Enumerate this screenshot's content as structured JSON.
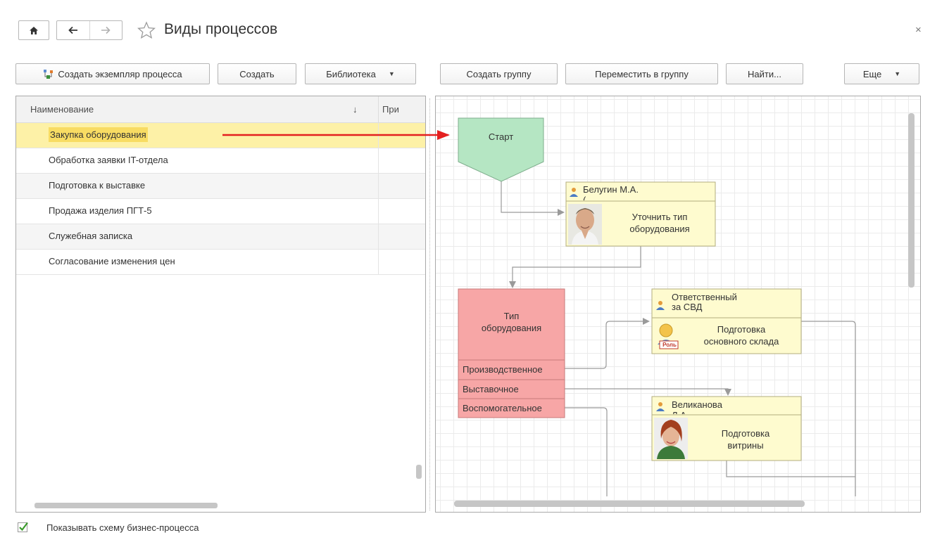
{
  "window": {
    "title": "Виды процессов",
    "close": "×"
  },
  "toolbar": {
    "create_instance": "Создать экземпляр процесса",
    "create": "Создать",
    "library": "Библиотека",
    "create_group": "Создать группу",
    "move_to_group": "Переместить в группу",
    "find": "Найти...",
    "more": "Еще"
  },
  "list": {
    "col_name": "Наименование",
    "sort_indicator": "↓",
    "col_pri": "При",
    "rows": [
      "Закупка оборудования",
      "Обработка заявки IT-отдела",
      "Подготовка к выставке",
      "Продажа изделия ПГТ-5",
      "Служебная записка",
      "Согласование изменения цен"
    ]
  },
  "flow": {
    "start": "Старт",
    "task1": {
      "assignee": "Белугин М.А.",
      "assignee_more": "(",
      "line1": "Уточнить тип",
      "line2": "оборудования"
    },
    "condition": {
      "line1": "Тип",
      "line2": "оборудования",
      "options": [
        "Производственное",
        "Выставочное",
        "Воспомогательное"
      ]
    },
    "task2": {
      "assignee1": "Ответственный",
      "assignee2": "за СВД",
      "line1": "Подготовка",
      "line2": "основного склада",
      "role_badge": "Роль"
    },
    "task3": {
      "assignee": "Великанова",
      "assignee_more": "Л.А.",
      "line1": "Подготовка",
      "line2": "витрины"
    }
  },
  "footer": {
    "show_scheme": "Показывать схему бизнес-процесса",
    "show_scheme_checked": true
  },
  "colors": {
    "start_fill": "#b5e6c3",
    "condition_fill": "#f7a6a6",
    "task_fill": "#fefbcf",
    "selected_row": "#fdf1a7",
    "arrow_red": "#e41f1f",
    "check_green": "#3a9a2a"
  }
}
